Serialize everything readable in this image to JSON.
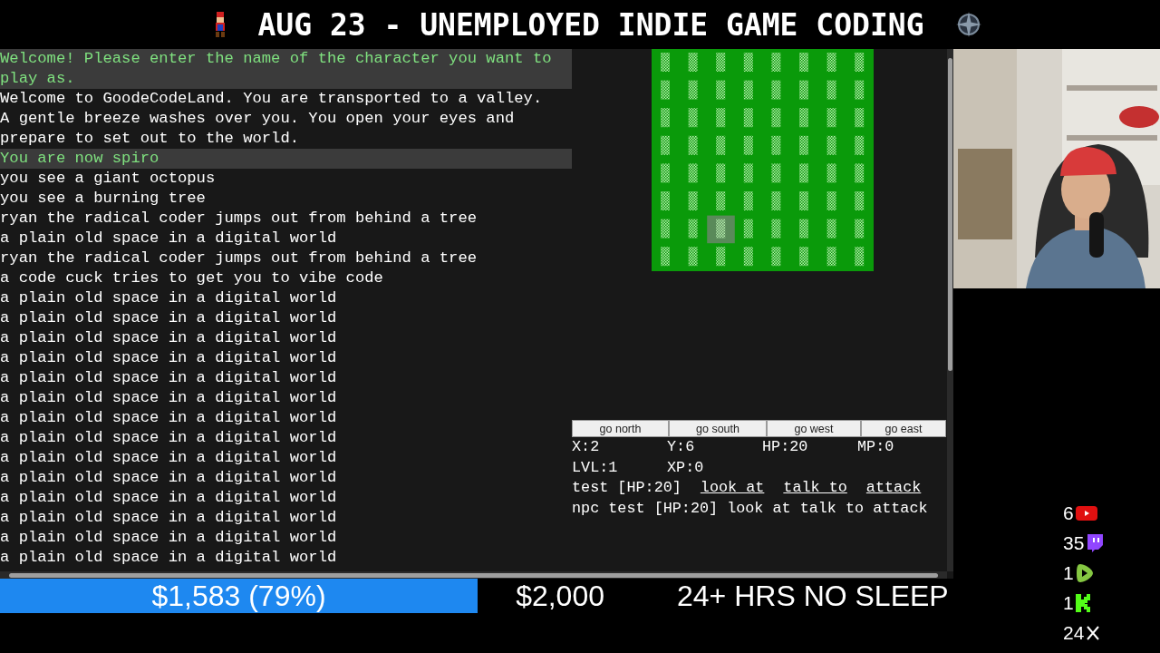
{
  "banner": {
    "title": "AUG 23 - UNEMPLOYED INDIE GAME CODING"
  },
  "log": [
    {
      "text": "Welcome! Please enter the name of the character you want to play as.",
      "kind": "system"
    },
    {
      "text": "Welcome to GoodeCodeLand. You are transported to a valley. A gentle breeze washes over you. You open your eyes and prepare to set out to the world.",
      "kind": "plain"
    },
    {
      "text": "You are now spiro",
      "kind": "system"
    },
    {
      "text": "you see a giant octopus",
      "kind": "plain"
    },
    {
      "text": "you see a burning tree",
      "kind": "plain"
    },
    {
      "text": "ryan the radical coder jumps out from behind a tree",
      "kind": "plain"
    },
    {
      "text": "a plain old space in a digital world",
      "kind": "plain"
    },
    {
      "text": "ryan the radical coder jumps out from behind a tree",
      "kind": "plain"
    },
    {
      "text": "a code cuck tries to get you to vibe code",
      "kind": "plain"
    },
    {
      "text": "a plain old space in a digital world",
      "kind": "plain"
    },
    {
      "text": "a plain old space in a digital world",
      "kind": "plain"
    },
    {
      "text": "a plain old space in a digital world",
      "kind": "plain"
    },
    {
      "text": "a plain old space in a digital world",
      "kind": "plain"
    },
    {
      "text": "a plain old space in a digital world",
      "kind": "plain"
    },
    {
      "text": "a plain old space in a digital world",
      "kind": "plain"
    },
    {
      "text": "a plain old space in a digital world",
      "kind": "plain"
    },
    {
      "text": "a plain old space in a digital world",
      "kind": "plain"
    },
    {
      "text": "a plain old space in a digital world",
      "kind": "plain"
    },
    {
      "text": "a plain old space in a digital world",
      "kind": "plain"
    },
    {
      "text": "a plain old space in a digital world",
      "kind": "plain"
    },
    {
      "text": "a plain old space in a digital world",
      "kind": "plain"
    },
    {
      "text": "a plain old space in a digital world",
      "kind": "plain"
    },
    {
      "text": "a plain old space in a digital world",
      "kind": "plain"
    }
  ],
  "map": {
    "rows": [
      [
        false,
        false,
        false,
        false,
        false,
        false,
        false,
        false
      ],
      [
        false,
        false,
        false,
        false,
        false,
        false,
        false,
        false
      ],
      [
        false,
        false,
        false,
        false,
        false,
        false,
        false,
        false
      ],
      [
        false,
        false,
        false,
        false,
        false,
        false,
        false,
        false
      ],
      [
        false,
        false,
        false,
        false,
        false,
        false,
        false,
        false
      ],
      [
        false,
        false,
        false,
        false,
        false,
        false,
        false,
        false
      ],
      [
        false,
        false,
        true,
        false,
        false,
        false,
        false,
        false
      ],
      [
        false,
        false,
        false,
        false,
        false,
        false,
        false,
        false
      ]
    ]
  },
  "buttons": [
    "go north",
    "go south",
    "go west",
    "go east"
  ],
  "stats": [
    "X:2",
    "Y:6",
    "HP:20",
    "MP:0",
    "LVL:1",
    "XP:0"
  ],
  "entities": [
    {
      "name": "test [HP:20]",
      "linked": true,
      "actions": [
        "look at",
        "talk to",
        "attack"
      ]
    },
    {
      "name": "npc test [HP:20]",
      "linked": false,
      "actions": [
        "look at",
        "talk to",
        "attack"
      ]
    }
  ],
  "goal": {
    "raised": "$1,583 (79%)",
    "target": "$2,000",
    "level": 0.79
  },
  "tagline": "24+ HRS NO SLEEP",
  "viewers": [
    {
      "count": "6",
      "kind": "youtube"
    },
    {
      "count": "35",
      "kind": "twitch"
    },
    {
      "count": "1",
      "kind": "rumble"
    },
    {
      "count": "1",
      "kind": "kick"
    },
    {
      "count": "24",
      "kind": "x"
    }
  ]
}
